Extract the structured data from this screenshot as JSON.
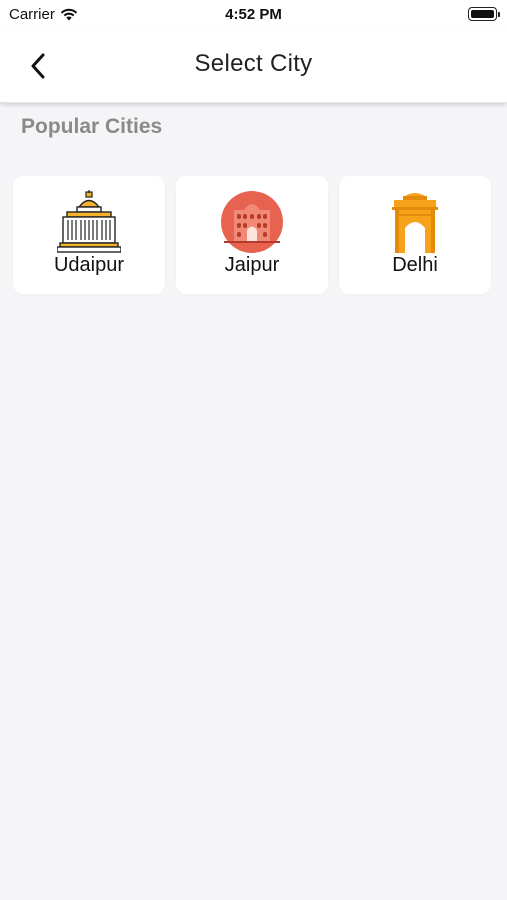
{
  "status_bar": {
    "carrier": "Carrier",
    "time": "4:52 PM"
  },
  "header": {
    "title": "Select City"
  },
  "section": {
    "title": "Popular Cities"
  },
  "cities": [
    {
      "label": "Udaipur",
      "icon": "palace-icon"
    },
    {
      "label": "Jaipur",
      "icon": "hawa-mahal-icon"
    },
    {
      "label": "Delhi",
      "icon": "india-gate-icon"
    }
  ],
  "colors": {
    "background": "#f5f5f7",
    "card": "#ffffff",
    "section_title": "#8a8a8a",
    "jaipur_accent": "#e8634f",
    "delhi_accent": "#f7a21b"
  }
}
